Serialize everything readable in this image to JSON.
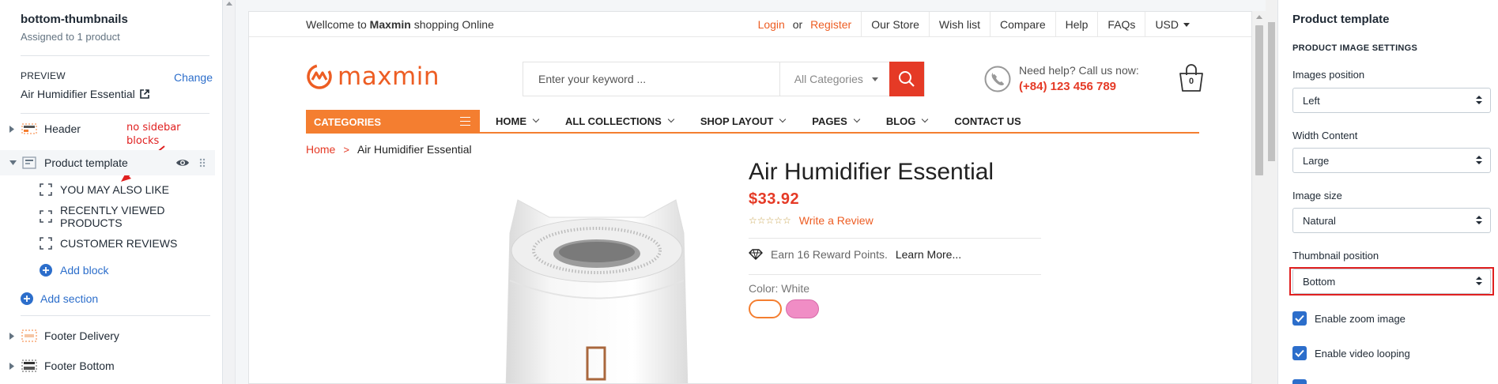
{
  "left_panel": {
    "template_name": "bottom-thumbnails",
    "template_sub": "Assigned to 1 product",
    "preview_label": "PREVIEW",
    "preview_change": "Change",
    "preview_product": "Air Humidifier Essential",
    "sections": {
      "header": "Header",
      "product_template": "Product template",
      "blocks": [
        "YOU MAY ALSO LIKE",
        "RECENTLY VIEWED PRODUCTS",
        "CUSTOMER REVIEWS"
      ],
      "add_block": "Add block",
      "add_section": "Add section",
      "footer_delivery": "Footer Delivery",
      "footer_bottom": "Footer Bottom"
    },
    "annotation": [
      "no sidebar",
      "blocks"
    ],
    "annotation_color": "#e02020"
  },
  "store": {
    "welcome_pre": "Wellcome to",
    "welcome_brand": "Maxmin",
    "welcome_post": "shopping Online",
    "login": "Login",
    "or": "or",
    "register": "Register",
    "top_links": [
      "Our Store",
      "Wish list",
      "Compare",
      "Help",
      "FAQs"
    ],
    "currency": "USD",
    "logo_text": "maxmin",
    "search_placeholder": "Enter your keyword ...",
    "search_category": "All Categories",
    "help_question": "Need help? Call us now:",
    "help_phone": "(+84) 123 456 789",
    "cart_count": "0",
    "categories_label": "CATEGORIES",
    "menu": [
      "HOME",
      "ALL COLLECTIONS",
      "SHOP LAYOUT",
      "PAGES",
      "BLOG",
      "CONTACT US"
    ],
    "breadcrumb_home": "Home",
    "breadcrumb_sep": ">",
    "breadcrumb_current": "Air Humidifier Essential",
    "product_title": "Air Humidifier Essential",
    "price": "$33.92",
    "stars": "☆☆☆☆☆",
    "write_review": "Write a Review",
    "reward_text": "Earn 16 Reward Points.",
    "learn_more": "Learn More...",
    "color_label": "Color: White",
    "accent_color": "#f47e30",
    "price_color": "#e53a26"
  },
  "right_panel": {
    "title": "Product template",
    "section_heading": "PRODUCT IMAGE SETTINGS",
    "fields": [
      {
        "label": "Images position",
        "value": "Left"
      },
      {
        "label": "Width Content",
        "value": "Large"
      },
      {
        "label": "Image size",
        "value": "Natural"
      },
      {
        "label": "Thumbnail position",
        "value": "Bottom"
      }
    ],
    "checkboxes": [
      {
        "label": "Enable zoom image",
        "checked": true
      },
      {
        "label": "Enable video looping",
        "checked": true
      }
    ],
    "highlight_color": "#e02020",
    "accent_color": "#2c6ecb"
  }
}
